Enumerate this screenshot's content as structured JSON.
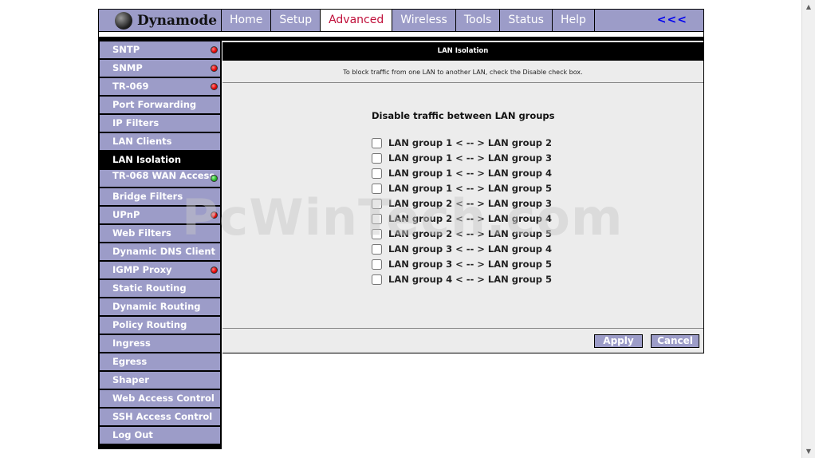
{
  "brand": {
    "name": "Dynamode"
  },
  "nav": {
    "tabs": [
      "Home",
      "Setup",
      "Advanced",
      "Wireless",
      "Tools",
      "Status",
      "Help"
    ],
    "active": "Advanced",
    "back_label": "<<<"
  },
  "sidebar": {
    "items": [
      {
        "label": "SNTP",
        "status": "red"
      },
      {
        "label": "SNMP",
        "status": "red"
      },
      {
        "label": "TR-069",
        "status": "red"
      },
      {
        "label": "Port Forwarding",
        "status": ""
      },
      {
        "label": "IP Filters",
        "status": ""
      },
      {
        "label": "LAN Clients",
        "status": ""
      },
      {
        "label": "LAN Isolation",
        "status": "",
        "active": true
      },
      {
        "label": "TR-068 WAN Access",
        "status": "green"
      },
      {
        "label": "Bridge Filters",
        "status": ""
      },
      {
        "label": "UPnP",
        "status": "red"
      },
      {
        "label": "Web Filters",
        "status": ""
      },
      {
        "label": "Dynamic DNS Client",
        "status": ""
      },
      {
        "label": "IGMP Proxy",
        "status": "red"
      },
      {
        "label": "Static Routing",
        "status": ""
      },
      {
        "label": "Dynamic Routing",
        "status": ""
      },
      {
        "label": "Policy Routing",
        "status": ""
      },
      {
        "label": "Ingress",
        "status": ""
      },
      {
        "label": "Egress",
        "status": ""
      },
      {
        "label": "Shaper",
        "status": ""
      },
      {
        "label": "Web Access Control",
        "status": ""
      },
      {
        "label": "SSH Access Control",
        "status": ""
      },
      {
        "label": "Log Out",
        "status": ""
      }
    ]
  },
  "main": {
    "title": "LAN Isolation",
    "description": "To block traffic from one LAN to another LAN, check the Disable check box.",
    "heading": "Disable traffic between LAN groups",
    "options": [
      {
        "label": "LAN group 1 < -- > LAN group 2",
        "checked": false
      },
      {
        "label": "LAN group 1 < -- > LAN group 3",
        "checked": false
      },
      {
        "label": "LAN group 1 < -- > LAN group 4",
        "checked": false
      },
      {
        "label": "LAN group 1 < -- > LAN group 5",
        "checked": false
      },
      {
        "label": "LAN group 2 < -- > LAN group 3",
        "checked": false
      },
      {
        "label": "LAN group 2 < -- > LAN group 4",
        "checked": false
      },
      {
        "label": "LAN group 2 < -- > LAN group 5",
        "checked": false
      },
      {
        "label": "LAN group 3 < -- > LAN group 4",
        "checked": false
      },
      {
        "label": "LAN group 3 < -- > LAN group 5",
        "checked": false
      },
      {
        "label": "LAN group 4 < -- > LAN group 5",
        "checked": false
      }
    ],
    "apply_label": "Apply",
    "cancel_label": "Cancel"
  },
  "watermark": "PcWinTech.com",
  "colors": {
    "menu_bg": "#9c9cc8",
    "active_tab_text": "#c0103a",
    "status_red": "#e00000",
    "status_green": "#20b020",
    "link_blue": "#0000ee"
  }
}
